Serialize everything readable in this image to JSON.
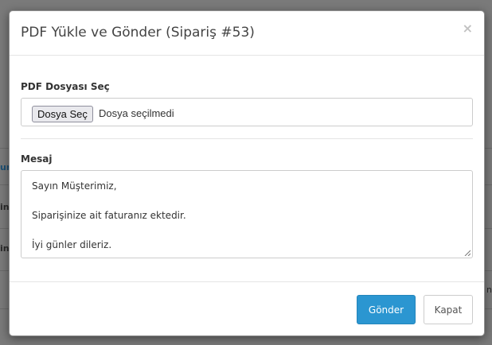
{
  "modal": {
    "title": "PDF Yükle ve Gönder (Sipariş #53)",
    "close_glyph": "×"
  },
  "pdf_field": {
    "label": "PDF Dosyası Seç",
    "button_label": "Dosya Seç",
    "status": "Dosya seçilmedi"
  },
  "message_field": {
    "label": "Mesaj",
    "lines": [
      "Sayın Müşterimiz,",
      "",
      "Siparişinize ait faturanız ektedir.",
      "",
      "İyi günler dileriz."
    ]
  },
  "footer": {
    "send_label": "Gönder",
    "close_label": "Kapat"
  },
  "background_fragments": [
    "ur",
    "in",
    "in",
    "n"
  ],
  "colors": {
    "primary": "#2b96d1",
    "overlay": "#7a7a7a"
  }
}
